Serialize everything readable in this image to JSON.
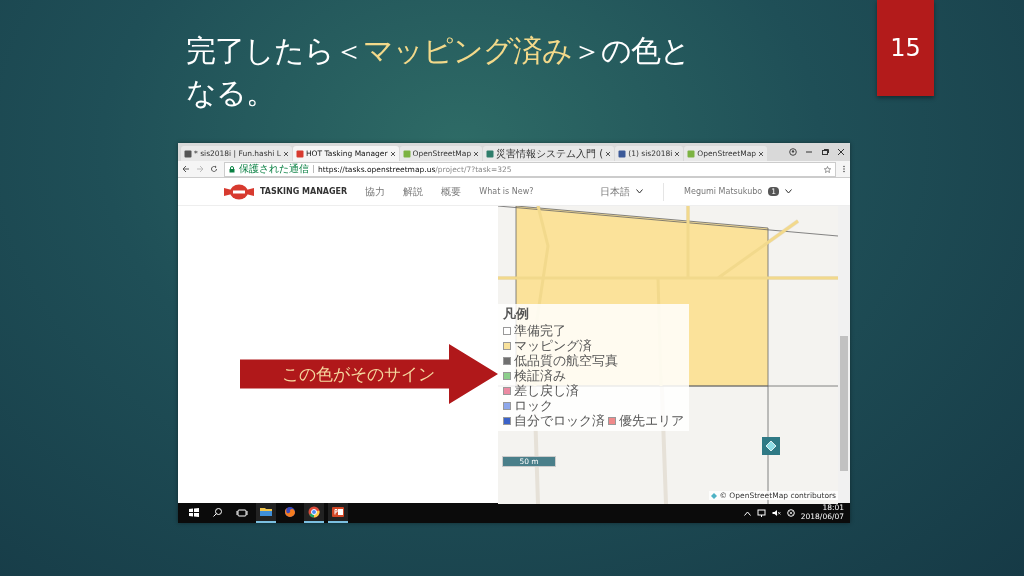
{
  "slide": {
    "title": [
      {
        "text": "完了したら＜",
        "highlight": false
      },
      {
        "text": "マッピング済み",
        "highlight": true
      },
      {
        "text": "＞の色となる。",
        "highlight": false
      }
    ],
    "page_number": "15"
  },
  "browser": {
    "tabs": [
      {
        "label": "* sis2018i | Fun.hashi L",
        "selected": false
      },
      {
        "label": "HOT Tasking Manager",
        "selected": true
      },
      {
        "label": "OpenStreetMap",
        "selected": false
      },
      {
        "label": "災害情報システム入門 (",
        "selected": false
      },
      {
        "label": "(1) sis2018i",
        "selected": false
      },
      {
        "label": "OpenStreetMap",
        "selected": false
      }
    ],
    "security": "保護された通信",
    "url_host": "https://tasks.openstreetmap.us",
    "url_path": "/project/7?task=325"
  },
  "site": {
    "brand": "TASKING MANAGER",
    "nav": [
      "協力",
      "解説",
      "概要",
      "What is New?"
    ],
    "language": "日本語",
    "user": "Megumi Matsukubo",
    "user_badge": "1"
  },
  "map": {
    "legend_title": "凡例",
    "legend": [
      {
        "label": "準備完了",
        "color": "#ffffff"
      },
      {
        "label": "マッピング済",
        "color": "#f9e29c"
      },
      {
        "label": "低品質の航空写真",
        "color": "#6f6f6f"
      },
      {
        "label": "検証済み",
        "color": "#8ccf8c"
      },
      {
        "label": "差し戻し済",
        "color": "#ec8aa2"
      },
      {
        "label": "ロック",
        "color": "#8ea8ec"
      },
      {
        "label": "自分でロック済",
        "color": "#3a62c8"
      },
      {
        "label": "優先エリア",
        "color": "#f08a8a"
      }
    ],
    "scale": "50 m",
    "attribution": "© OpenStreetMap contributors"
  },
  "callout": "この色がそのサイン",
  "taskbar": {
    "apps": [
      {
        "kind": "explorer",
        "running": true
      },
      {
        "kind": "firefox",
        "running": false
      },
      {
        "kind": "chrome",
        "running": true
      },
      {
        "kind": "powerpoint",
        "running": true
      }
    ],
    "time": "18:01",
    "date": "2018/06/07"
  }
}
